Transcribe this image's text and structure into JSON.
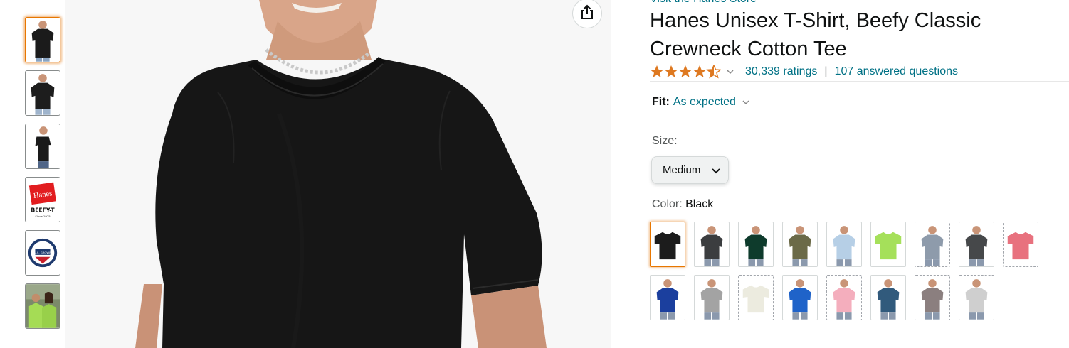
{
  "store_link": "Visit the Hanes Store",
  "title": "Hanes Unisex T-Shirt, Beefy Classic Crewneck Cotton Tee",
  "rating": {
    "stars": 4.5,
    "count_text": "30,339 ratings",
    "separator": "|",
    "questions_text": "107 answered questions"
  },
  "fit": {
    "label": "Fit:",
    "value": "As expected"
  },
  "size": {
    "label": "Size:",
    "selected": "Medium"
  },
  "color": {
    "label": "Color:",
    "selected": "Black"
  },
  "thumbnails": [
    {
      "name": "thumbnail-front",
      "selected": true
    },
    {
      "name": "thumbnail-model",
      "selected": false
    },
    {
      "name": "thumbnail-side",
      "selected": false
    },
    {
      "name": "thumbnail-hanes-logo",
      "selected": false
    },
    {
      "name": "thumbnail-us-cotton-seal",
      "selected": false
    },
    {
      "name": "thumbnail-lifestyle",
      "selected": false
    }
  ],
  "swatches": [
    {
      "color": "#1c1c1c",
      "style": "flat",
      "selected": true,
      "available": true
    },
    {
      "color": "#3b3d3f",
      "style": "model",
      "selected": false,
      "available": true
    },
    {
      "color": "#0e3b2c",
      "style": "model",
      "selected": false,
      "available": true
    },
    {
      "color": "#6b6a48",
      "style": "model",
      "selected": false,
      "available": true
    },
    {
      "color": "#b6cfe6",
      "style": "model",
      "selected": false,
      "available": true
    },
    {
      "color": "#a5e05a",
      "style": "flat",
      "selected": false,
      "available": true
    },
    {
      "color": "#8e9bab",
      "style": "model",
      "selected": false,
      "available": false
    },
    {
      "color": "#46484a",
      "style": "model",
      "selected": false,
      "available": true
    },
    {
      "color": "#e8717e",
      "style": "flat",
      "selected": false,
      "available": false
    },
    {
      "color": "#1b3f9e",
      "style": "model",
      "selected": false,
      "available": true
    },
    {
      "color": "#a3a3a3",
      "style": "model",
      "selected": false,
      "available": true
    },
    {
      "color": "#ecebdf",
      "style": "flat",
      "selected": false,
      "available": false
    },
    {
      "color": "#1f63c9",
      "style": "model",
      "selected": false,
      "available": true
    },
    {
      "color": "#f4aebd",
      "style": "model",
      "selected": false,
      "available": false
    },
    {
      "color": "#315a7c",
      "style": "model",
      "selected": false,
      "available": true
    },
    {
      "color": "#8b7f7f",
      "style": "model",
      "selected": false,
      "available": false
    },
    {
      "color": "#cfcfcf",
      "style": "model",
      "selected": false,
      "available": false
    }
  ],
  "colors": {
    "link": "#007185",
    "star": "#de7921",
    "selected_border": "#e77600"
  },
  "icons": {
    "share": "share-icon",
    "dropdown": "chevron-down-icon",
    "star": "star-icon"
  }
}
